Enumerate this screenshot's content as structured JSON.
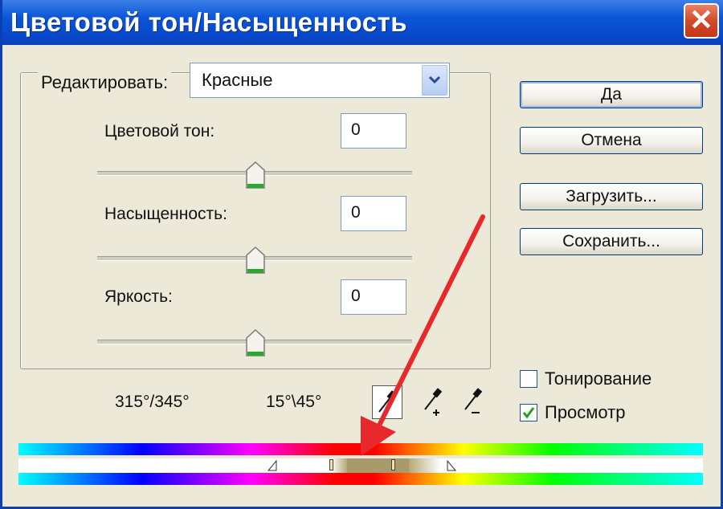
{
  "window": {
    "title": "Цветовой тон/Насыщенность",
    "close_glyph": "✕"
  },
  "edit": {
    "label": "Редактировать:",
    "selected": "Красные"
  },
  "adjustments": [
    {
      "label": "Цветовой тон:",
      "value": "0",
      "slider_fraction": 0.5
    },
    {
      "label": "Насыщенность:",
      "value": "0",
      "slider_fraction": 0.5
    },
    {
      "label": "Яркость:",
      "value": "0",
      "slider_fraction": 0.5
    }
  ],
  "buttons": {
    "ok": "Да",
    "cancel": "Отмена",
    "load": "Загрузить...",
    "save": "Сохранить..."
  },
  "checkboxes": {
    "colorize": {
      "label": "Тонирование",
      "checked": false
    },
    "preview": {
      "label": "Просмотр",
      "checked": true
    }
  },
  "range": {
    "left": "315°/345°",
    "right": "15°\\45°"
  },
  "icons": [
    "chevron-down-icon",
    "eyedropper-icon",
    "eyedropper-plus-icon",
    "eyedropper-minus-icon",
    "close-icon"
  ],
  "colors": {
    "titlebar": "#0a55d8",
    "annotation_arrow": "#e8282b",
    "checkmark": "#21a121"
  }
}
